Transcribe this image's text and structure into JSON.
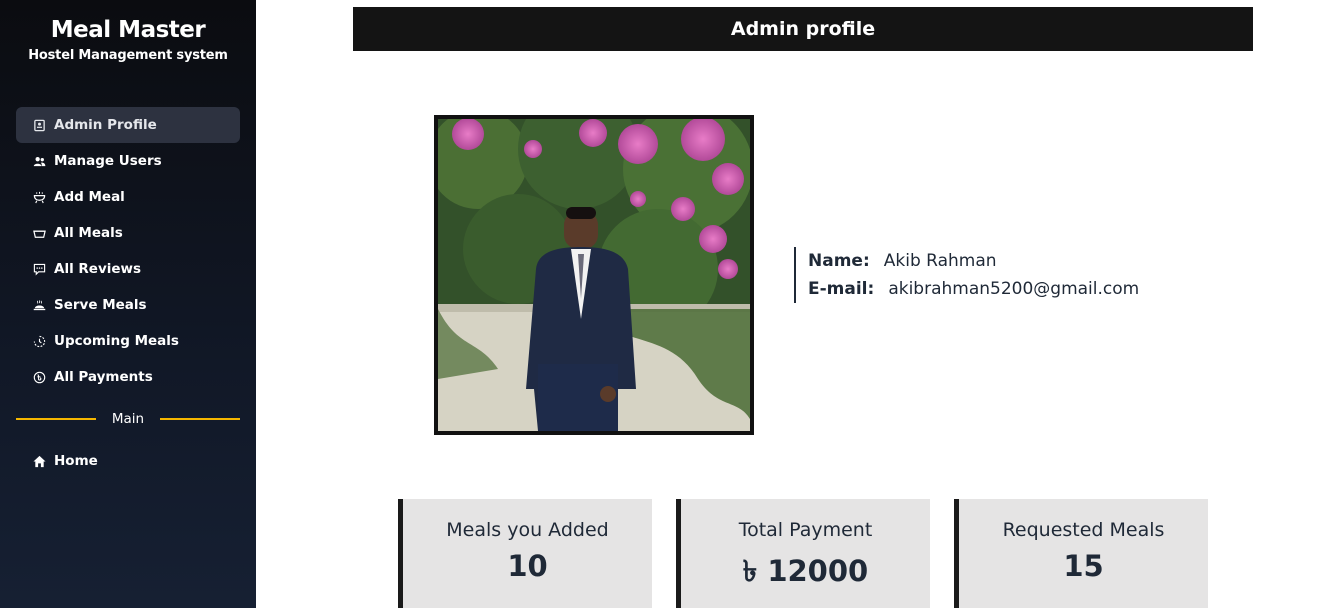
{
  "brand": {
    "title": "Meal Master",
    "subtitle": "Hostel Management system"
  },
  "sidebar": {
    "items": [
      {
        "label": "Admin Profile",
        "icon": "profile-icon",
        "active": true
      },
      {
        "label": "Manage Users",
        "icon": "users-icon"
      },
      {
        "label": "Add Meal",
        "icon": "add-meal-icon"
      },
      {
        "label": "All Meals",
        "icon": "meals-icon"
      },
      {
        "label": "All Reviews",
        "icon": "reviews-icon"
      },
      {
        "label": "Serve Meals",
        "icon": "serve-icon"
      },
      {
        "label": "Upcoming Meals",
        "icon": "upcoming-icon"
      },
      {
        "label": "All Payments",
        "icon": "payments-icon"
      }
    ],
    "divider_label": "Main",
    "secondary": [
      {
        "label": "Home",
        "icon": "home-icon"
      }
    ]
  },
  "header": {
    "title": "Admin profile"
  },
  "profile": {
    "name_label": "Name:",
    "name": "Akib Rahman",
    "email_label": "E-mail:",
    "email": "akibrahman5200@gmail.com"
  },
  "stats": [
    {
      "title": "Meals you Added",
      "value": "10"
    },
    {
      "title": "Total Payment",
      "value": "৳ 12000"
    },
    {
      "title": "Requested Meals",
      "value": "15"
    }
  ],
  "colors": {
    "accent": "#f5b700",
    "header_bg": "#141414",
    "card_bg": "#e5e4e4"
  }
}
